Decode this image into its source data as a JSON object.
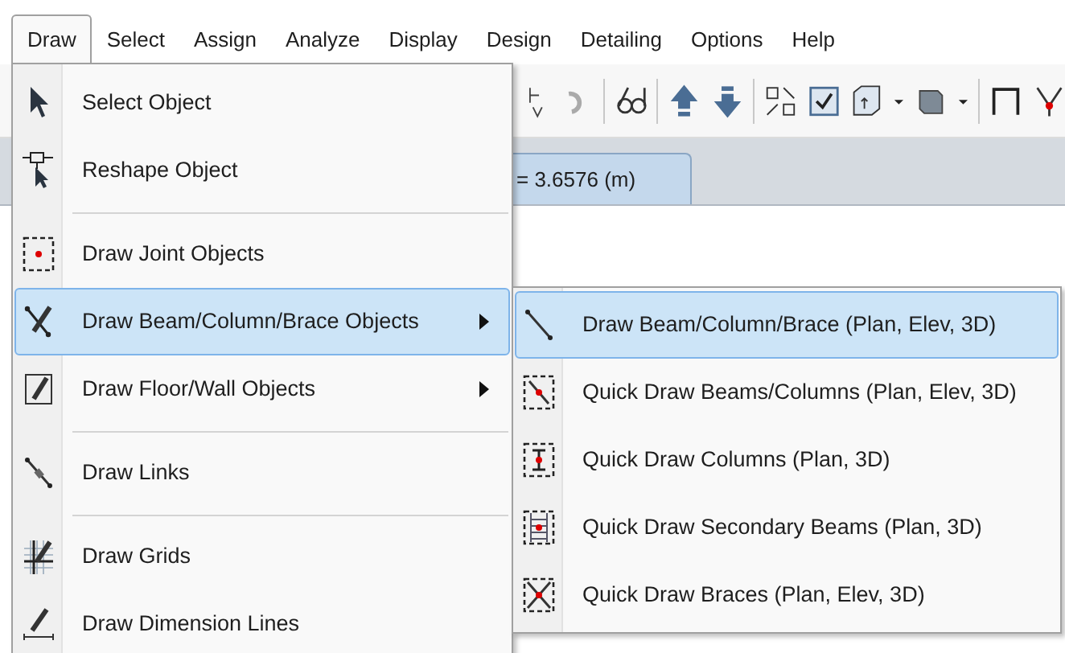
{
  "menu_bar": [
    {
      "label": "Draw",
      "selected": true
    },
    {
      "label": "Select",
      "selected": false
    },
    {
      "label": "Assign",
      "selected": false
    },
    {
      "label": "Analyze",
      "selected": false
    },
    {
      "label": "Display",
      "selected": false
    },
    {
      "label": "Design",
      "selected": false
    },
    {
      "label": "Detailing",
      "selected": false
    },
    {
      "label": "Options",
      "selected": false
    },
    {
      "label": "Help",
      "selected": false
    }
  ],
  "view_tab": {
    "label": "= 3.6576 (m)"
  },
  "draw_menu": {
    "items": [
      {
        "kind": "item",
        "label": "Select Object",
        "has_submenu": false,
        "selected": false
      },
      {
        "kind": "item",
        "label": "Reshape Object",
        "has_submenu": false,
        "selected": false
      },
      {
        "kind": "separator"
      },
      {
        "kind": "item",
        "label": "Draw Joint Objects",
        "has_submenu": false,
        "selected": false
      },
      {
        "kind": "item",
        "label": "Draw Beam/Column/Brace Objects",
        "has_submenu": true,
        "selected": true
      },
      {
        "kind": "item",
        "label": "Draw Floor/Wall Objects",
        "has_submenu": true,
        "selected": false
      },
      {
        "kind": "separator"
      },
      {
        "kind": "item",
        "label": "Draw Links",
        "has_submenu": false,
        "selected": false
      },
      {
        "kind": "separator"
      },
      {
        "kind": "item",
        "label": "Draw Grids",
        "has_submenu": false,
        "selected": false
      },
      {
        "kind": "item",
        "label": "Draw Dimension Lines",
        "has_submenu": false,
        "selected": false
      }
    ]
  },
  "submenu": {
    "items": [
      {
        "label": "Draw Beam/Column/Brace (Plan, Elev, 3D)",
        "selected": true
      },
      {
        "label": "Quick Draw Beams/Columns (Plan, Elev, 3D)",
        "selected": false
      },
      {
        "label": "Quick Draw Columns (Plan, 3D)",
        "selected": false
      },
      {
        "label": "Quick Draw Secondary Beams (Plan, 3D)",
        "selected": false
      },
      {
        "label": "Quick Draw Braces (Plan, Elev, 3D)",
        "selected": false
      }
    ]
  }
}
